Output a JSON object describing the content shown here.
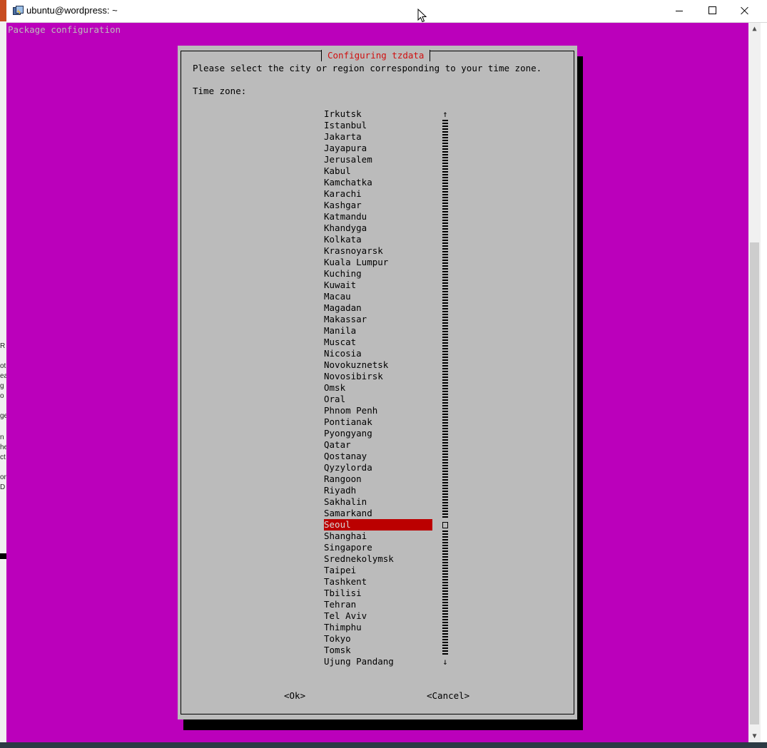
{
  "window": {
    "title": "ubuntu@wordpress: ~"
  },
  "terminal": {
    "header": "Package configuration"
  },
  "dialog": {
    "title": "Configuring tzdata",
    "prompt": "Please select the city or region corresponding to your time zone.",
    "field_label": "Time zone:",
    "selected": "Seoul",
    "items": [
      "Irkutsk",
      "Istanbul",
      "Jakarta",
      "Jayapura",
      "Jerusalem",
      "Kabul",
      "Kamchatka",
      "Karachi",
      "Kashgar",
      "Katmandu",
      "Khandyga",
      "Kolkata",
      "Krasnoyarsk",
      "Kuala Lumpur",
      "Kuching",
      "Kuwait",
      "Macau",
      "Magadan",
      "Makassar",
      "Manila",
      "Muscat",
      "Nicosia",
      "Novokuznetsk",
      "Novosibirsk",
      "Omsk",
      "Oral",
      "Phnom Penh",
      "Pontianak",
      "Pyongyang",
      "Qatar",
      "Qostanay",
      "Qyzylorda",
      "Rangoon",
      "Riyadh",
      "Sakhalin",
      "Samarkand",
      "Seoul",
      "Shanghai",
      "Singapore",
      "Srednekolymsk",
      "Taipei",
      "Tashkent",
      "Tbilisi",
      "Tehran",
      "Tel Aviv",
      "Thimphu",
      "Tokyo",
      "Tomsk",
      "Ujung Pandang"
    ],
    "ok_label": "<Ok>",
    "cancel_label": "<Cancel>",
    "scroll_up_glyph": "↑",
    "scroll_down_glyph": "↓"
  },
  "left_fragments": [
    "R",
    "ot",
    "ea",
    "g",
    "o",
    "ge",
    "n",
    "he",
    "ct",
    "or",
    "D"
  ],
  "colors": {
    "terminal_bg": "#bb00bb",
    "dialog_bg": "#bbbbbb",
    "title_red": "#d01010",
    "selection": "#bb0000"
  }
}
